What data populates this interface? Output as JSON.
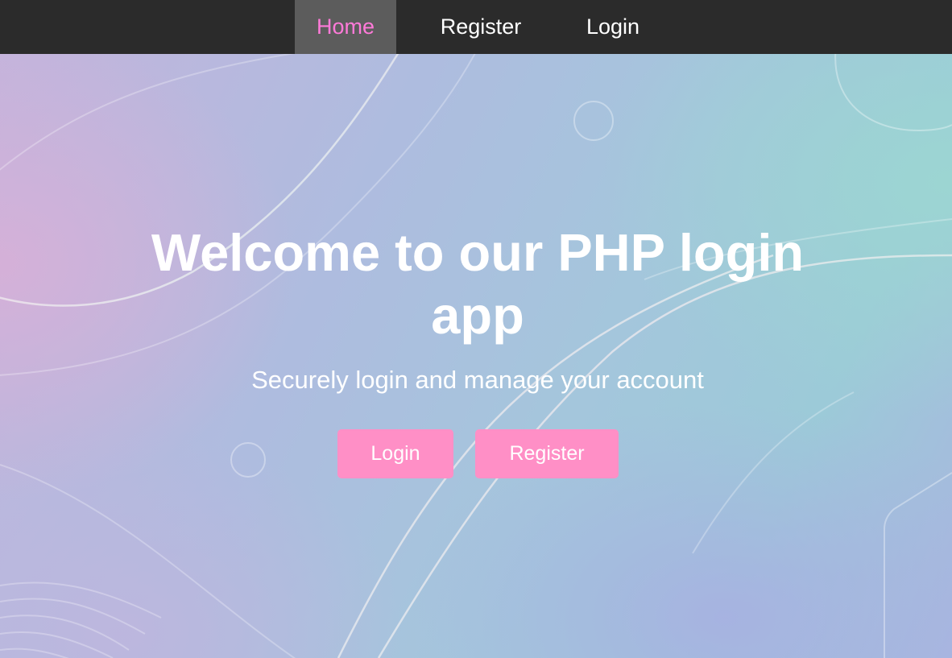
{
  "nav": {
    "items": [
      {
        "label": "Home",
        "active": true
      },
      {
        "label": "Register",
        "active": false
      },
      {
        "label": "Login",
        "active": false
      }
    ]
  },
  "hero": {
    "title": "Welcome to our PHP login app",
    "subtitle": "Securely login and manage your account",
    "login_button": "Login",
    "register_button": "Register"
  },
  "colors": {
    "navbar_bg": "#2b2b2b",
    "nav_active_bg": "#5c5c5c",
    "nav_active_text": "#ff7ad9",
    "nav_text": "#ffffff",
    "button_bg": "#ff8fc6",
    "button_text": "#ffffff"
  }
}
